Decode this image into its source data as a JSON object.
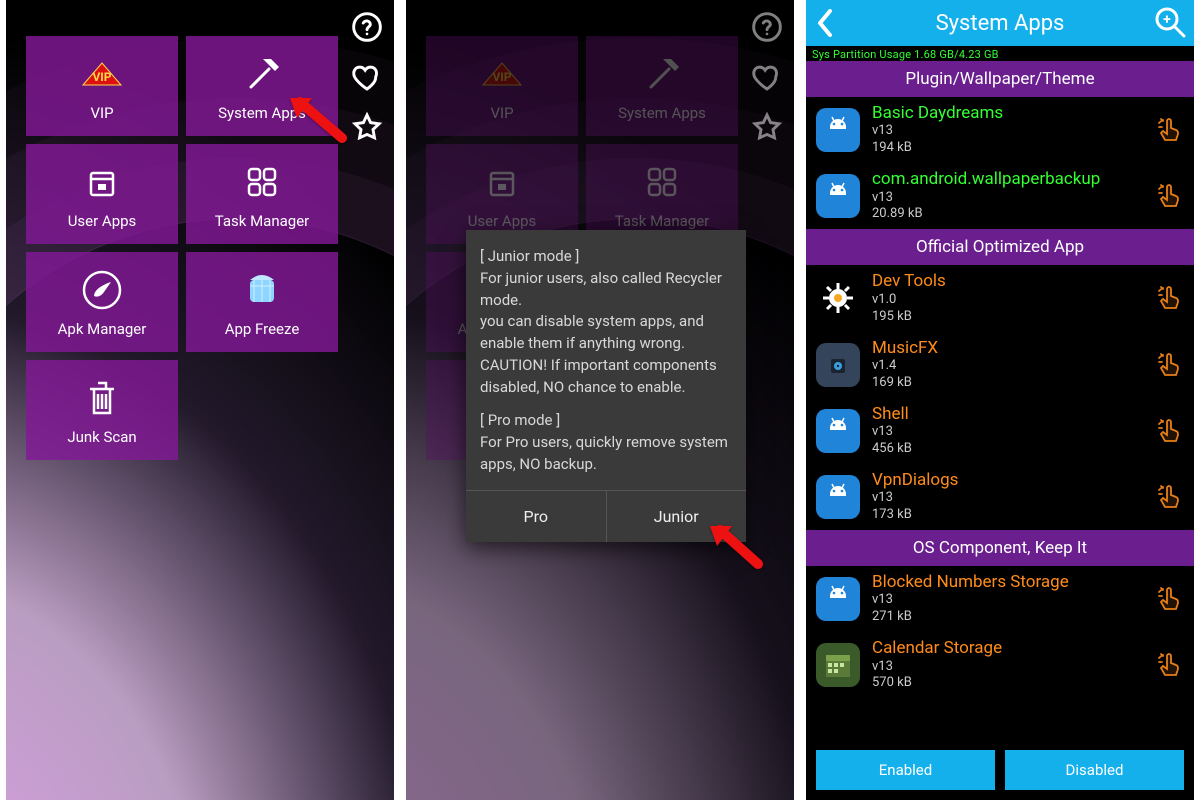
{
  "panel1": {
    "side_icons": [
      "help-icon",
      "heart-icon",
      "star-icon"
    ],
    "tiles": [
      {
        "name": "vip-tile",
        "label": "VIP",
        "icon": "vip"
      },
      {
        "name": "system-apps-tile",
        "label": "System Apps",
        "icon": "hammer"
      },
      {
        "name": "user-apps-tile",
        "label": "User Apps",
        "icon": "box"
      },
      {
        "name": "task-manager-tile",
        "label": "Task Manager",
        "icon": "grid"
      },
      {
        "name": "apk-manager-tile",
        "label": "Apk Manager",
        "icon": "brush"
      },
      {
        "name": "app-freeze-tile",
        "label": "App Freeze",
        "icon": "ice"
      },
      {
        "name": "junk-scan-tile",
        "label": "Junk Scan",
        "icon": "trash"
      }
    ]
  },
  "panel2": {
    "dialog": {
      "junior_h": "[ Junior mode ]",
      "junior_l1": " For junior users, also called Recycler mode.",
      "junior_l2": " you can disable system apps, and enable them if anything wrong.",
      "junior_l3": " CAUTION! If important components disabled, NO chance to enable.",
      "pro_h": "[ Pro mode ]",
      "pro_l1": " For Pro users, quickly remove system apps, NO backup.",
      "btn_pro": "Pro",
      "btn_junior": "Junior"
    }
  },
  "panel3": {
    "title": "System Apps",
    "usage": "Sys Partition Usage 1.68 GB/4.23 GB",
    "sections": [
      {
        "header": "Plugin/Wallpaper/Theme",
        "apps": [
          {
            "name": "Basic Daydreams",
            "color": "green",
            "ver": "v13",
            "size": "194 kB",
            "icon": "android"
          },
          {
            "name": "com.android.wallpaperbackup",
            "color": "green",
            "ver": "v13",
            "size": "20.89 kB",
            "icon": "android"
          }
        ]
      },
      {
        "header": "Official Optimized App",
        "apps": [
          {
            "name": "Dev Tools",
            "color": "orange",
            "ver": "v1.0",
            "size": "195 kB",
            "icon": "gear"
          },
          {
            "name": "MusicFX",
            "color": "orange",
            "ver": "v1.4",
            "size": "169 kB",
            "icon": "music"
          },
          {
            "name": "Shell",
            "color": "orange",
            "ver": "v13",
            "size": "456 kB",
            "icon": "android"
          },
          {
            "name": "VpnDialogs",
            "color": "orange",
            "ver": "v13",
            "size": "173 kB",
            "icon": "android"
          }
        ]
      },
      {
        "header": "OS Component, Keep It",
        "apps": [
          {
            "name": "Blocked Numbers Storage",
            "color": "orange",
            "ver": "v13",
            "size": "271 kB",
            "icon": "android"
          },
          {
            "name": "Calendar Storage",
            "color": "orange",
            "ver": "v13",
            "size": "570 kB",
            "icon": "calendar"
          }
        ]
      }
    ],
    "buttons": {
      "enabled": "Enabled",
      "disabled": "Disabled"
    }
  }
}
